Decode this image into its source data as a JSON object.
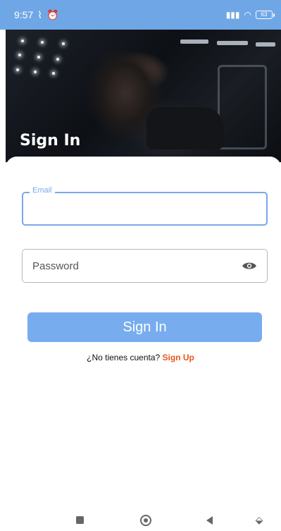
{
  "status_bar": {
    "time": "9:57",
    "icons": [
      "vpn-icon",
      "alarm-icon",
      "signal-icon",
      "wifi-icon",
      "battery-icon"
    ],
    "battery_level": "63",
    "background": "#6fa7e6"
  },
  "hero": {
    "title": "Sign In"
  },
  "form": {
    "email_label": "Email",
    "email_value": "",
    "password_placeholder": "Password",
    "submit_label": "Sign In",
    "prompt_text": "¿No tienes cuenta?",
    "signup_label": "Sign Up"
  },
  "colors": {
    "accent": "#77acef",
    "focus_border": "#79a8e8",
    "link": "#e6561f"
  },
  "nav_bar": {
    "icons": [
      "recents-square-icon",
      "home-circle-icon",
      "back-triangle-icon",
      "nav-collapse-icon"
    ]
  }
}
